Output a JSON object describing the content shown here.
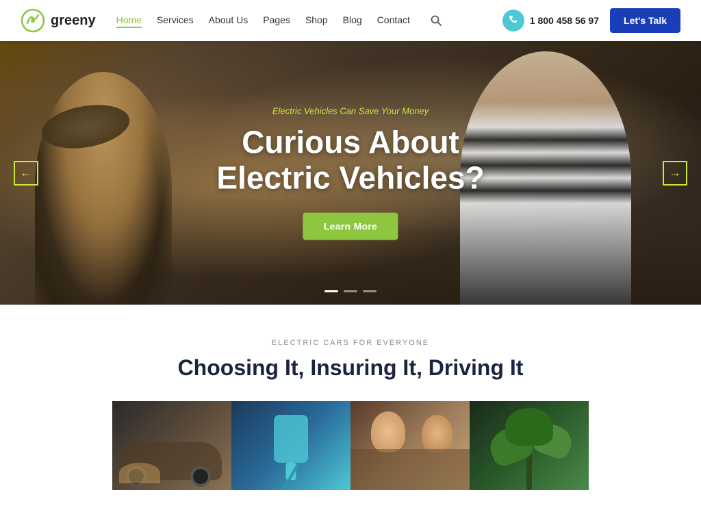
{
  "logo": {
    "text": "greeny",
    "icon_label": "greeny-logo-icon"
  },
  "navbar": {
    "links": [
      {
        "label": "Home",
        "active": true
      },
      {
        "label": "Services",
        "active": false
      },
      {
        "label": "About Us",
        "active": false
      },
      {
        "label": "Pages",
        "active": false
      },
      {
        "label": "Shop",
        "active": false
      },
      {
        "label": "Blog",
        "active": false
      },
      {
        "label": "Contact",
        "active": false
      }
    ],
    "phone_number": "1 800 458 56 97",
    "lets_talk_label": "Let's Talk"
  },
  "hero": {
    "subtitle": "Electric Vehicles Can Save Your Money",
    "title_line1": "Curious About",
    "title_line2": "Electric Vehicles?",
    "button_label": "Learn More",
    "prev_arrow": "←",
    "next_arrow": "→",
    "dots": [
      {
        "active": true
      },
      {
        "active": false
      },
      {
        "active": false
      }
    ]
  },
  "section2": {
    "label": "ELECTRIC CARS FOR EVERYONE",
    "title": "Choosing It, Insuring It, Driving It",
    "cards": [
      {
        "bg_class": "card-img-1",
        "alt": "Electric car exterior"
      },
      {
        "bg_class": "card-img-2",
        "alt": "EV charging port"
      },
      {
        "bg_class": "card-img-3",
        "alt": "Happy drivers"
      },
      {
        "bg_class": "card-img-4",
        "alt": "Green nature"
      }
    ]
  }
}
